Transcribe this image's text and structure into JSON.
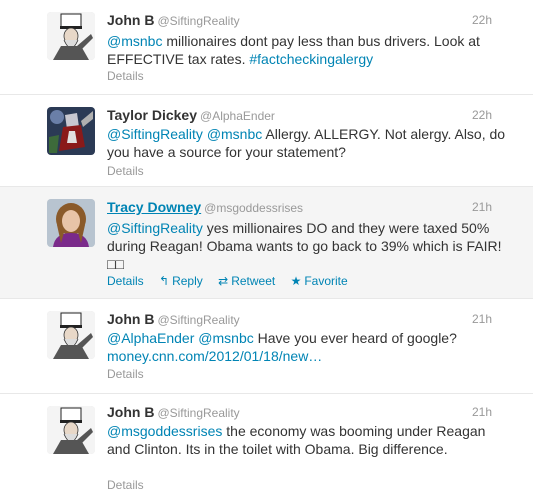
{
  "tweets": [
    {
      "name": "John B",
      "handle": "@SiftingReality",
      "time": "22h",
      "mention1": "@msnbc",
      "text1": " millionaires dont pay less than bus drivers. Look at EFFECTIVE tax rates. ",
      "hashtag": "#factcheckingalergy",
      "details": "Details"
    },
    {
      "name": "Taylor Dickey",
      "handle": "@AlphaEnder",
      "time": "22h",
      "mention1": "@SiftingReality",
      "mention2": "@msnbc",
      "text1": " Allergy. ALLERGY. Not alergy. Also, do you have a source for your statement?",
      "details": "Details"
    },
    {
      "name": "Tracy Downey",
      "handle": "@msgoddessrises",
      "time": "21h",
      "mention1": "@SiftingReality",
      "text1": " yes millionaires DO and they were taxed 50% during Reagan! Obama wants to go back to 39% which is FAIR!□□",
      "details": "Details",
      "reply": "Reply",
      "retweet": "Retweet",
      "favorite": "Favorite"
    },
    {
      "name": "John B",
      "handle": "@SiftingReality",
      "time": "21h",
      "mention1": "@AlphaEnder",
      "mention2": "@msnbc",
      "text1": " Have you ever heard of google?",
      "url": "money.cnn.com/2012/01/18/new…",
      "details": "Details"
    },
    {
      "name": "John B",
      "handle": "@SiftingReality",
      "time": "21h",
      "mention1": "@msgoddessrises",
      "text1": " the economy was booming under Reagan and Clinton. Its in the toilet with Obama. Big difference.",
      "details": "Details"
    }
  ],
  "colors": {
    "link": "#0084b4",
    "meta": "#999999",
    "hover_bg": "#f5f5f5"
  },
  "icons": {
    "reply": "reply-arrow-icon",
    "retweet": "retweet-icon",
    "favorite": "star-icon"
  }
}
